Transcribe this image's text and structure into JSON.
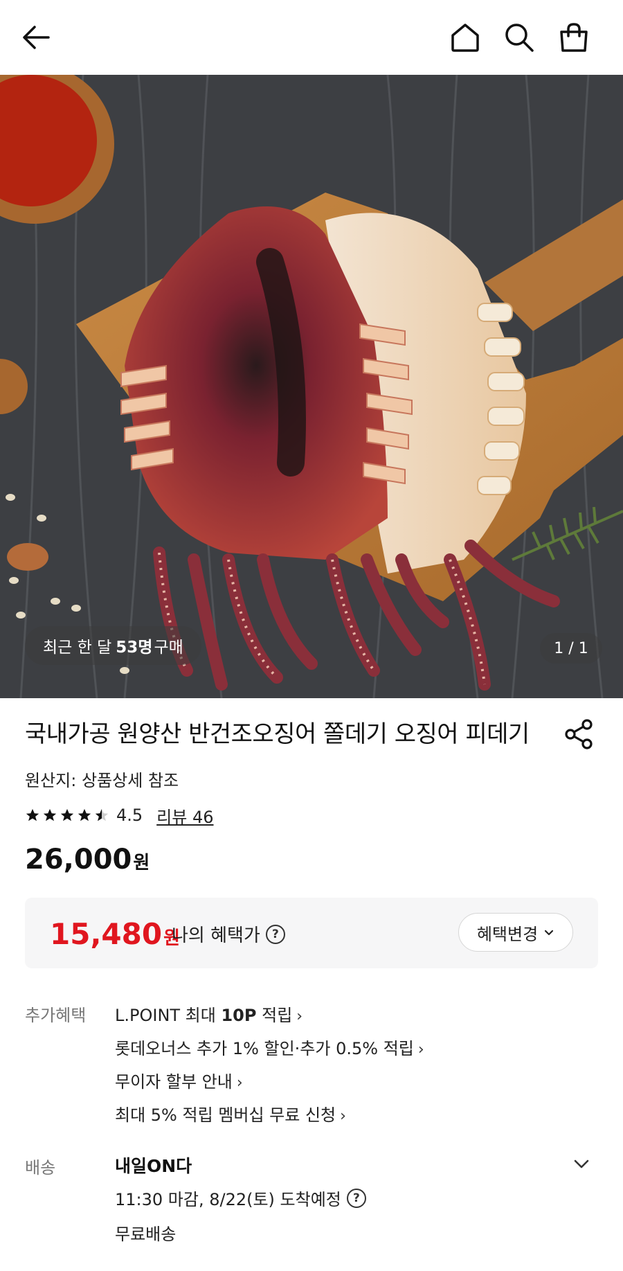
{
  "header": {
    "back_icon": "arrow-left-icon",
    "home_icon": "home-icon",
    "search_icon": "search-icon",
    "bag_icon": "shopping-bag-icon"
  },
  "hero": {
    "buyers_prefix": "최근 한 달",
    "buyers_count": "53명",
    "buyers_suffix": "구매",
    "counter": "1 / 1"
  },
  "product": {
    "title": "국내가공 원양산 반건조오징어 쫄데기 오징어 피데기",
    "origin": "원산지: 상품상세 참조",
    "rating": "4.5",
    "rating_value": 4.5,
    "review": "리뷰 46",
    "price": "26,000",
    "price_unit": "원"
  },
  "benefit": {
    "price": "15,480",
    "price_unit": "원",
    "label": "나의 혜택가",
    "help": "?",
    "change_button": "혜택변경"
  },
  "extra_benefits": {
    "label": "추가혜택",
    "items": [
      {
        "pre": "L.POINT 최대 ",
        "bold": "10P",
        "post": " 적립"
      },
      {
        "pre": "롯데오너스 추가 1% 할인·추가 0.5% 적립",
        "bold": "",
        "post": ""
      },
      {
        "pre": "무이자 할부 안내",
        "bold": "",
        "post": ""
      },
      {
        "pre": "최대 5% 적립 멤버십 무료 신청",
        "bold": "",
        "post": ""
      }
    ],
    "chevron": "›"
  },
  "shipping": {
    "label": "배송",
    "title": "내일ON다",
    "deadline": "11:30 마감, 8/22(토) 도착예정",
    "help": "?",
    "fee": "무료배송"
  },
  "colors": {
    "accent_red": "#e0161f",
    "benefit_bg": "#f6f6f7"
  }
}
